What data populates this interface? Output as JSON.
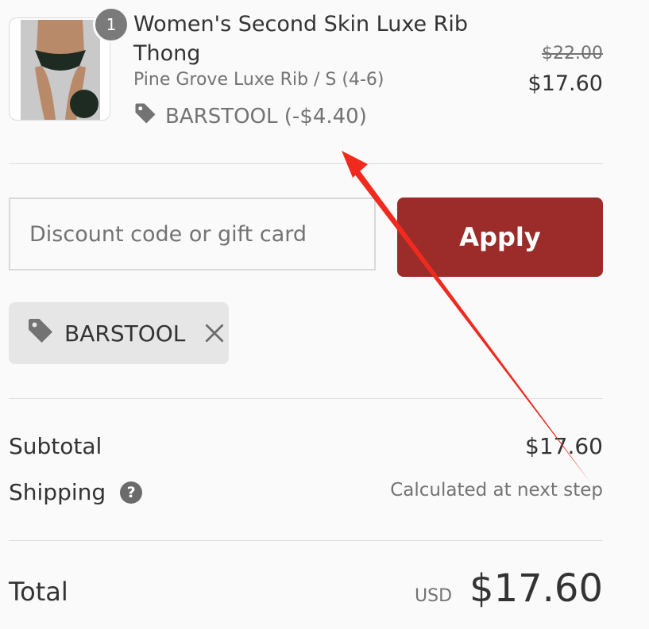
{
  "line_item": {
    "quantity": "1",
    "title": "Women's Second Skin Luxe Rib Thong",
    "variant": "Pine Grove Luxe Rib / S (4-6)",
    "discount": "BARSTOOL (-$4.40)",
    "original_price": "$22.00",
    "price": "$17.60"
  },
  "discount_form": {
    "placeholder": "Discount code or gift card",
    "apply_label": "Apply"
  },
  "applied_code": {
    "code": "BARSTOOL"
  },
  "summary": {
    "subtotal_label": "Subtotal",
    "subtotal_value": "$17.60",
    "shipping_label": "Shipping",
    "shipping_value": "Calculated at next step",
    "total_label": "Total",
    "currency": "USD",
    "total_value": "$17.60"
  },
  "colors": {
    "accent": "#9b2c29",
    "annotation_arrow": "#f02a1e",
    "product_swatch": "#1e2b22"
  },
  "icons": {
    "tag": "tag-icon",
    "remove": "close-icon",
    "help": "question-icon"
  }
}
